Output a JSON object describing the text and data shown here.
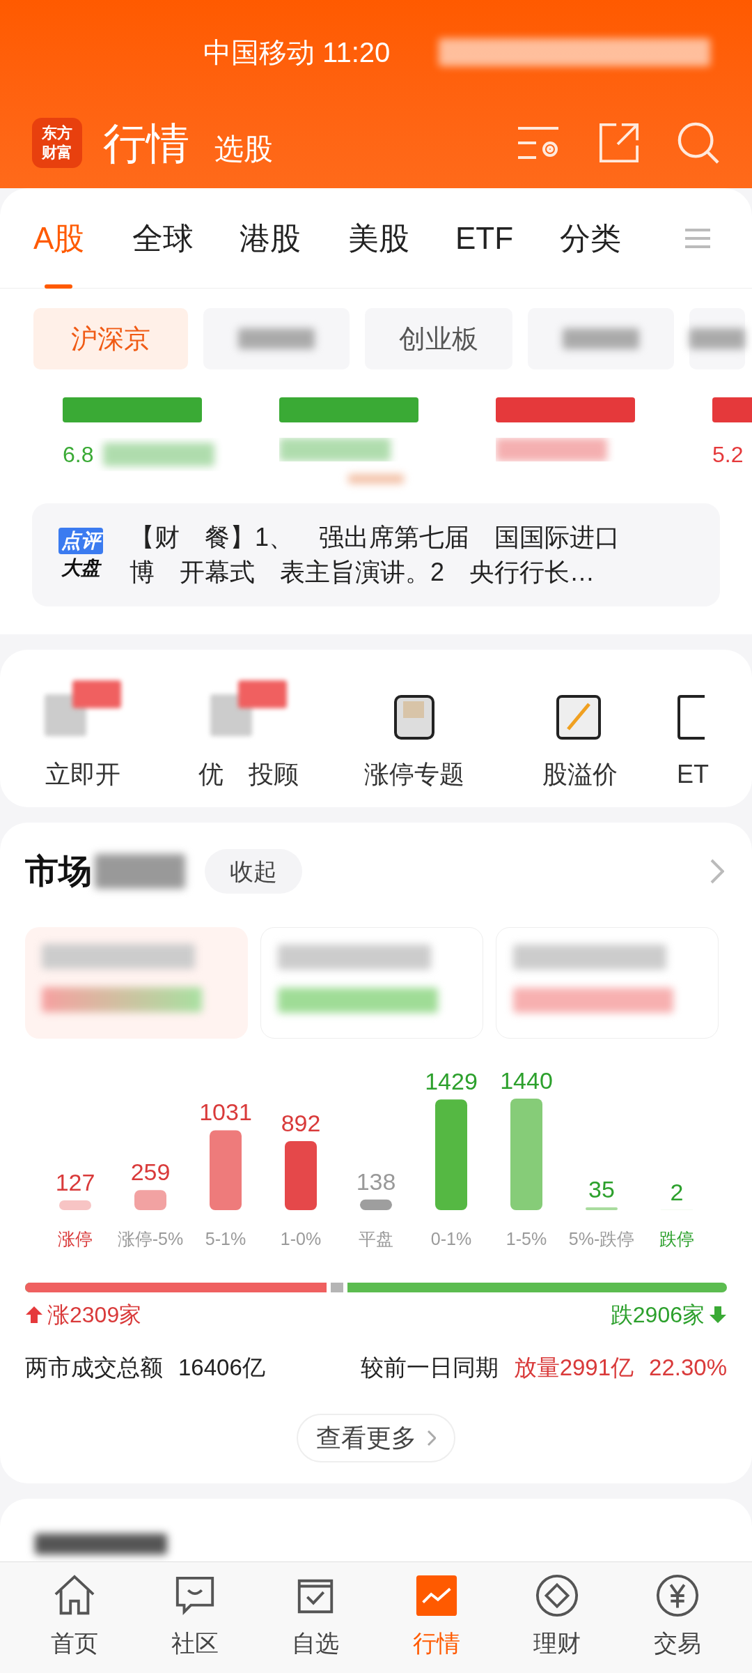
{
  "status_bar": {
    "carrier": "中国移动",
    "time": "11:20"
  },
  "header": {
    "logo": "东方财富",
    "title": "行情",
    "subtitle": "选股"
  },
  "tabs": [
    {
      "label": "A股",
      "selected": true
    },
    {
      "label": "全球",
      "selected": false
    },
    {
      "label": "港股",
      "selected": false
    },
    {
      "label": "美股",
      "selected": false
    },
    {
      "label": "ETF",
      "selected": false
    },
    {
      "label": "分类",
      "selected": false
    }
  ],
  "chips": [
    {
      "kind": "text",
      "label": "沪深京",
      "selected": true
    },
    {
      "kind": "blurred",
      "selected": false
    },
    {
      "kind": "text",
      "label": "创业板",
      "selected": false
    },
    {
      "kind": "blurred",
      "selected": false
    },
    {
      "kind": "blurred",
      "selected": false
    }
  ],
  "indices": [
    {
      "color": "#3aaa35",
      "fragment": "6.8"
    },
    {
      "color": "#3aaa35"
    },
    {
      "color": "#e5393b"
    },
    {
      "color": "#e5393b",
      "fragment": "5.2"
    }
  ],
  "news": {
    "badge_top": "点评",
    "badge_bottom": "大盘",
    "lines": [
      "【财　餐】1、　强出席第七届　国国际进口",
      "博　开幕式　表主旨演讲。2　央行行长…"
    ]
  },
  "shortcuts": [
    {
      "label": "立即开",
      "kind": "blurred"
    },
    {
      "label": "优　投顾",
      "kind": "blurred"
    },
    {
      "label": "涨停专题",
      "kind": "box"
    },
    {
      "label": "股溢价",
      "kind": "ah"
    },
    {
      "label": "ET",
      "kind": "etf"
    }
  ],
  "market": {
    "title": "市场",
    "collapse": "收起",
    "chart_data": {
      "type": "bar",
      "categories": [
        "涨停",
        "涨停-5%",
        "5-1%",
        "1-0%",
        "平盘",
        "0-1%",
        "1-5%",
        "5%-跌停",
        "跌停"
      ],
      "series": [
        {
          "color": "#f7c4c4",
          "values": [
            127,
            null,
            null,
            null,
            null,
            null,
            null,
            null,
            null
          ]
        },
        {
          "color": "#f2a2a2",
          "values": [
            null,
            259,
            null,
            null,
            null,
            null,
            null,
            null,
            null
          ]
        },
        {
          "color": "#ee7b7b",
          "values": [
            null,
            null,
            1031,
            null,
            null,
            null,
            null,
            null,
            null
          ]
        },
        {
          "color": "#e5484a",
          "values": [
            null,
            null,
            null,
            892,
            null,
            null,
            null,
            null,
            null
          ]
        },
        {
          "color": "#9e9e9e",
          "values": [
            null,
            null,
            null,
            null,
            138,
            null,
            null,
            null,
            null
          ]
        },
        {
          "color": "#55b843",
          "values": [
            null,
            null,
            null,
            null,
            null,
            1429,
            null,
            null,
            null
          ]
        },
        {
          "color": "#86cc78",
          "values": [
            null,
            null,
            null,
            null,
            null,
            null,
            1440,
            null,
            null
          ]
        },
        {
          "color": "#a9dc9e",
          "values": [
            null,
            null,
            null,
            null,
            null,
            null,
            null,
            35,
            null
          ]
        },
        {
          "color": "#c9e9c2",
          "values": [
            null,
            null,
            null,
            null,
            null,
            null,
            null,
            null,
            2
          ]
        }
      ],
      "data_labels": true
    },
    "breadth": {
      "level": 0.43,
      "up": "涨2309家",
      "down": "跌2906家"
    },
    "turnover_label": "两市成交总额",
    "turnover": "16406亿",
    "compare_label": "较前一日同期",
    "compare_volume": "放量2991亿",
    "compare_pct": "22.30%",
    "more": "查看更多"
  },
  "bottom_nav": [
    {
      "label": "首页",
      "selected": false
    },
    {
      "label": "社区",
      "selected": false
    },
    {
      "label": "自选",
      "selected": false
    },
    {
      "label": "行情",
      "selected": true
    },
    {
      "label": "理财",
      "selected": false
    },
    {
      "label": "交易",
      "selected": false
    }
  ]
}
